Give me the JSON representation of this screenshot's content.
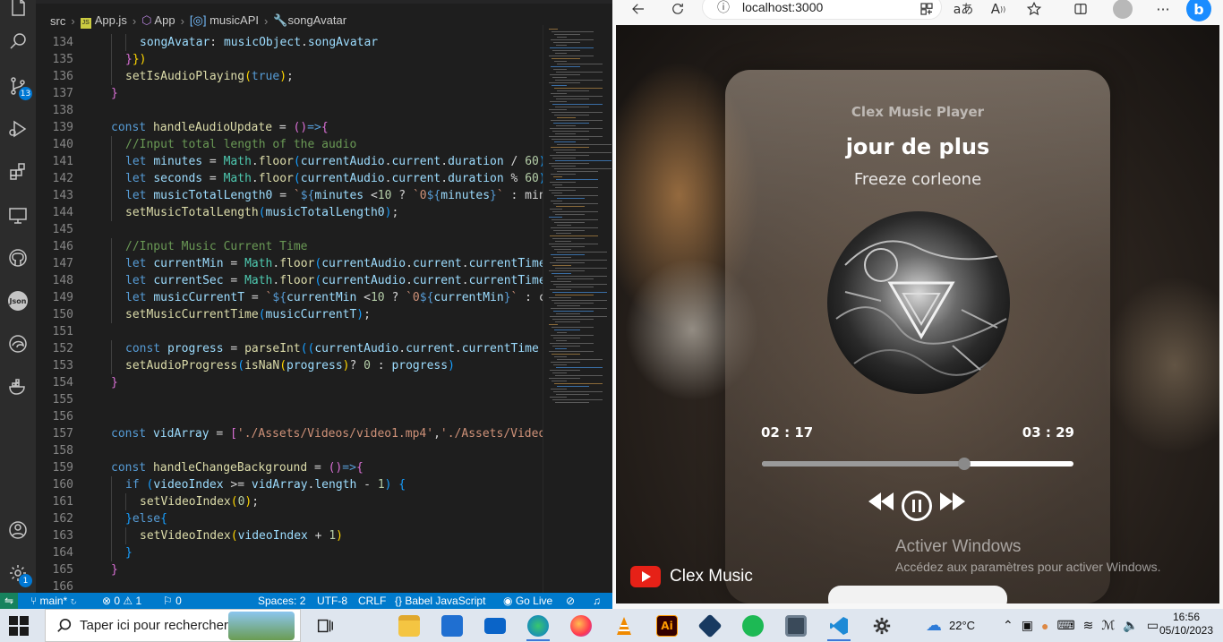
{
  "vscode": {
    "breadcrumb": [
      "src",
      "App.js",
      "App",
      "musicAPI",
      "songAvatar"
    ],
    "scm_badge": "13",
    "accounts_badge": "1",
    "json_icon": "Json",
    "lines": [
      {
        "n": "134",
        "tokens": [
          [
            "v",
            "songAvatar"
          ],
          [
            "w",
            ": "
          ],
          [
            "v",
            "musicObject"
          ],
          [
            "w",
            "."
          ],
          [
            "v",
            "songAvatar"
          ]
        ],
        "indent": 3
      },
      {
        "n": "135",
        "tokens": [
          [
            "p2",
            "}"
          ],
          [
            "p",
            "})"
          ]
        ],
        "indent": 2
      },
      {
        "n": "136",
        "tokens": [
          [
            "f",
            "setIsAudioPlaying"
          ],
          [
            "p",
            "("
          ],
          [
            "k",
            "true"
          ],
          [
            "p",
            ")"
          ],
          [
            "w",
            ";"
          ]
        ],
        "indent": 2
      },
      {
        "n": "137",
        "tokens": [
          [
            "p2",
            "}"
          ]
        ],
        "indent": 1
      },
      {
        "n": "138",
        "tokens": [],
        "indent": 0
      },
      {
        "n": "139",
        "tokens": [
          [
            "k",
            "const "
          ],
          [
            "f",
            "handleAudioUpdate"
          ],
          [
            "w",
            " = "
          ],
          [
            "p2",
            "()"
          ],
          [
            "k",
            "=>"
          ],
          [
            "p2",
            "{"
          ]
        ],
        "indent": 1
      },
      {
        "n": "140",
        "tokens": [
          [
            "c",
            "//Input total length of the audio"
          ]
        ],
        "indent": 2
      },
      {
        "n": "141",
        "tokens": [
          [
            "k",
            "let "
          ],
          [
            "v",
            "minutes"
          ],
          [
            "w",
            " = "
          ],
          [
            "t",
            "Math"
          ],
          [
            "w",
            "."
          ],
          [
            "f",
            "floor"
          ],
          [
            "p3",
            "("
          ],
          [
            "v",
            "currentAudio"
          ],
          [
            "w",
            "."
          ],
          [
            "v",
            "current"
          ],
          [
            "w",
            "."
          ],
          [
            "v",
            "duration"
          ],
          [
            "w",
            " / "
          ],
          [
            "n",
            "60"
          ],
          [
            "p3",
            ")"
          ]
        ],
        "indent": 2
      },
      {
        "n": "142",
        "tokens": [
          [
            "k",
            "let "
          ],
          [
            "v",
            "seconds"
          ],
          [
            "w",
            " = "
          ],
          [
            "t",
            "Math"
          ],
          [
            "w",
            "."
          ],
          [
            "f",
            "floor"
          ],
          [
            "p3",
            "("
          ],
          [
            "v",
            "currentAudio"
          ],
          [
            "w",
            "."
          ],
          [
            "v",
            "current"
          ],
          [
            "w",
            "."
          ],
          [
            "v",
            "duration"
          ],
          [
            "w",
            " % "
          ],
          [
            "n",
            "60"
          ],
          [
            "p3",
            ")"
          ]
        ],
        "indent": 2
      },
      {
        "n": "143",
        "tokens": [
          [
            "k",
            "let "
          ],
          [
            "v",
            "musicTotalLength0"
          ],
          [
            "w",
            " = "
          ],
          [
            "s",
            "`"
          ],
          [
            "k",
            "${"
          ],
          [
            "v",
            "minutes"
          ],
          [
            "w",
            " <"
          ],
          [
            "n",
            "10"
          ],
          [
            "w",
            " ? "
          ],
          [
            "s",
            "`0"
          ],
          [
            "k",
            "${"
          ],
          [
            "v",
            "minutes"
          ],
          [
            "k",
            "}"
          ],
          [
            "s",
            "`"
          ],
          [
            "w",
            " : minu"
          ]
        ],
        "indent": 2
      },
      {
        "n": "144",
        "tokens": [
          [
            "f",
            "setMusicTotalLength"
          ],
          [
            "p3",
            "("
          ],
          [
            "v",
            "musicTotalLength0"
          ],
          [
            "p3",
            ")"
          ],
          [
            "w",
            ";"
          ]
        ],
        "indent": 2
      },
      {
        "n": "145",
        "tokens": [],
        "indent": 0
      },
      {
        "n": "146",
        "tokens": [
          [
            "c",
            "//Input Music Current Time"
          ]
        ],
        "indent": 2
      },
      {
        "n": "147",
        "tokens": [
          [
            "k",
            "let "
          ],
          [
            "v",
            "currentMin"
          ],
          [
            "w",
            " = "
          ],
          [
            "t",
            "Math"
          ],
          [
            "w",
            "."
          ],
          [
            "f",
            "floor"
          ],
          [
            "p3",
            "("
          ],
          [
            "v",
            "currentAudio"
          ],
          [
            "w",
            "."
          ],
          [
            "v",
            "current"
          ],
          [
            "w",
            "."
          ],
          [
            "v",
            "currentTime"
          ]
        ],
        "indent": 2
      },
      {
        "n": "148",
        "tokens": [
          [
            "k",
            "let "
          ],
          [
            "v",
            "currentSec"
          ],
          [
            "w",
            " = "
          ],
          [
            "t",
            "Math"
          ],
          [
            "w",
            "."
          ],
          [
            "f",
            "floor"
          ],
          [
            "p3",
            "("
          ],
          [
            "v",
            "currentAudio"
          ],
          [
            "w",
            "."
          ],
          [
            "v",
            "current"
          ],
          [
            "w",
            "."
          ],
          [
            "v",
            "currentTime"
          ]
        ],
        "indent": 2
      },
      {
        "n": "149",
        "tokens": [
          [
            "k",
            "let "
          ],
          [
            "v",
            "musicCurrentT"
          ],
          [
            "w",
            " = "
          ],
          [
            "s",
            "`"
          ],
          [
            "k",
            "${"
          ],
          [
            "v",
            "currentMin"
          ],
          [
            "w",
            " <"
          ],
          [
            "n",
            "10"
          ],
          [
            "w",
            " ? "
          ],
          [
            "s",
            "`0"
          ],
          [
            "k",
            "${"
          ],
          [
            "v",
            "currentMin"
          ],
          [
            "k",
            "}"
          ],
          [
            "s",
            "`"
          ],
          [
            "w",
            " : cu"
          ]
        ],
        "indent": 2
      },
      {
        "n": "150",
        "tokens": [
          [
            "f",
            "setMusicCurrentTime"
          ],
          [
            "p3",
            "("
          ],
          [
            "v",
            "musicCurrentT"
          ],
          [
            "p3",
            ")"
          ],
          [
            "w",
            ";"
          ]
        ],
        "indent": 2
      },
      {
        "n": "151",
        "tokens": [],
        "indent": 0
      },
      {
        "n": "152",
        "tokens": [
          [
            "k",
            "const "
          ],
          [
            "v",
            "progress"
          ],
          [
            "w",
            " = "
          ],
          [
            "f",
            "parseInt"
          ],
          [
            "p3",
            "(("
          ],
          [
            "v",
            "currentAudio"
          ],
          [
            "w",
            "."
          ],
          [
            "v",
            "current"
          ],
          [
            "w",
            "."
          ],
          [
            "v",
            "currentTime"
          ],
          [
            "w",
            " /"
          ]
        ],
        "indent": 2
      },
      {
        "n": "153",
        "tokens": [
          [
            "f",
            "setAudioProgress"
          ],
          [
            "p3",
            "("
          ],
          [
            "f",
            "isNaN"
          ],
          [
            "p",
            "("
          ],
          [
            "v",
            "progress"
          ],
          [
            "p",
            ")"
          ],
          [
            "w",
            "? "
          ],
          [
            "n",
            "0"
          ],
          [
            "w",
            " : "
          ],
          [
            "v",
            "progress"
          ],
          [
            "p3",
            ")"
          ]
        ],
        "indent": 2
      },
      {
        "n": "154",
        "tokens": [
          [
            "p2",
            "}"
          ]
        ],
        "indent": 1
      },
      {
        "n": "155",
        "tokens": [],
        "indent": 0
      },
      {
        "n": "156",
        "tokens": [],
        "indent": 0
      },
      {
        "n": "157",
        "tokens": [
          [
            "k",
            "const "
          ],
          [
            "v",
            "vidArray"
          ],
          [
            "w",
            " = "
          ],
          [
            "p2",
            "["
          ],
          [
            "s",
            "'./Assets/Videos/video1.mp4'"
          ],
          [
            "w",
            ","
          ],
          [
            "s",
            "'./Assets/Videos"
          ]
        ],
        "indent": 1
      },
      {
        "n": "158",
        "tokens": [],
        "indent": 0
      },
      {
        "n": "159",
        "tokens": [
          [
            "k",
            "const "
          ],
          [
            "f",
            "handleChangeBackground"
          ],
          [
            "w",
            " = "
          ],
          [
            "p2",
            "()"
          ],
          [
            "k",
            "=>"
          ],
          [
            "p2",
            "{"
          ]
        ],
        "indent": 1
      },
      {
        "n": "160",
        "tokens": [
          [
            "k",
            "if "
          ],
          [
            "p3",
            "("
          ],
          [
            "v",
            "videoIndex"
          ],
          [
            "w",
            " >= "
          ],
          [
            "v",
            "vidArray"
          ],
          [
            "w",
            "."
          ],
          [
            "v",
            "length"
          ],
          [
            "w",
            " - "
          ],
          [
            "n",
            "1"
          ],
          [
            "p3",
            ")"
          ],
          [
            "w",
            " "
          ],
          [
            "p3",
            "{"
          ]
        ],
        "indent": 2
      },
      {
        "n": "161",
        "tokens": [
          [
            "f",
            "setVideoIndex"
          ],
          [
            "p",
            "("
          ],
          [
            "n",
            "0"
          ],
          [
            "p",
            ")"
          ],
          [
            "w",
            ";"
          ]
        ],
        "indent": 3
      },
      {
        "n": "162",
        "tokens": [
          [
            "p3",
            "}"
          ],
          [
            "k",
            "else"
          ],
          [
            "p3",
            "{"
          ]
        ],
        "indent": 2
      },
      {
        "n": "163",
        "tokens": [
          [
            "f",
            "setVideoIndex"
          ],
          [
            "p",
            "("
          ],
          [
            "v",
            "videoIndex"
          ],
          [
            "w",
            " + "
          ],
          [
            "n",
            "1"
          ],
          [
            "p",
            ")"
          ]
        ],
        "indent": 3
      },
      {
        "n": "164",
        "tokens": [
          [
            "p3",
            "}"
          ]
        ],
        "indent": 2
      },
      {
        "n": "165",
        "tokens": [
          [
            "p2",
            "}"
          ]
        ],
        "indent": 1
      },
      {
        "n": "166",
        "tokens": [],
        "indent": 0
      }
    ],
    "status": {
      "branch": "main*",
      "errors": "⊗ 0 ⚠ 1",
      "warnings": "⚐ 0",
      "spaces": "Spaces: 2",
      "encoding": "UTF-8",
      "eol": "CRLF",
      "language": "{} Babel JavaScript",
      "golive": "Go Live"
    }
  },
  "browser": {
    "url": "localhost:3000",
    "player": {
      "app_label": "Clex Music Player",
      "song_title": "jour de plus",
      "artist": "Freeze corleone",
      "current_time": "02 : 17",
      "total_time": "03 : 29",
      "progress": 0.65
    },
    "brand": "Clex Music",
    "watermark_title": "Activer Windows",
    "watermark_sub": "Accédez aux paramètres pour activer Windows."
  },
  "taskbar": {
    "search_placeholder": "Taper ici pour rechercher",
    "weather": "22°C",
    "time": "16:56",
    "date": "05/10/2023",
    "apps": [
      "file-explorer",
      "microsoft-store",
      "mail",
      "edge",
      "firefox",
      "vlc",
      "illustrator",
      "virtualbox",
      "spotify",
      "calculator",
      "vscode",
      "settings"
    ]
  },
  "colors": {
    "vscode_status": "#007acc",
    "accent": "#3b78d8",
    "youtube_red": "#e62117"
  }
}
